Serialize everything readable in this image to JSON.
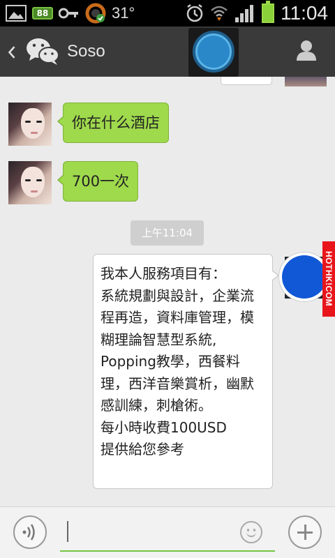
{
  "status_bar": {
    "battery_small_label": "88",
    "temperature": "31°",
    "time": "11:04",
    "icons": [
      "image-icon",
      "battery-small-icon",
      "key-icon",
      "sync-icon",
      "alarm-icon",
      "wifi-icon",
      "signal-icon",
      "battery-icon"
    ]
  },
  "header": {
    "title": "Soso",
    "icons": [
      "back-icon",
      "wechat-icon",
      "floating-assistant-icon",
      "profile-icon"
    ]
  },
  "messages": [
    {
      "side": "left",
      "text": "你在什么酒店"
    },
    {
      "side": "left",
      "text": "700一次"
    },
    {
      "type": "timestamp",
      "text": "上午11:04"
    },
    {
      "side": "right",
      "text": "我本人服務項目有：\n系統規劃與設計，企業流程再造，資料庫管理，模糊理論智慧型系統, Popping教學，西餐料理，西洋音樂賞析，幽默感訓練，刺槍術。\n每小時收費100USD\n提供給您參考"
    }
  ],
  "watermark": "HOTHK!COM",
  "input_bar": {
    "value": "",
    "icons": [
      "voice-icon",
      "emoji-icon",
      "plus-icon"
    ]
  },
  "colors": {
    "header_bg": "#3a3a3a",
    "chat_bg": "#ebebeb",
    "bubble_green": "#9fd94c",
    "bubble_white": "#ffffff",
    "accent": "#74c444",
    "watermark_bg": "#e8161b"
  }
}
